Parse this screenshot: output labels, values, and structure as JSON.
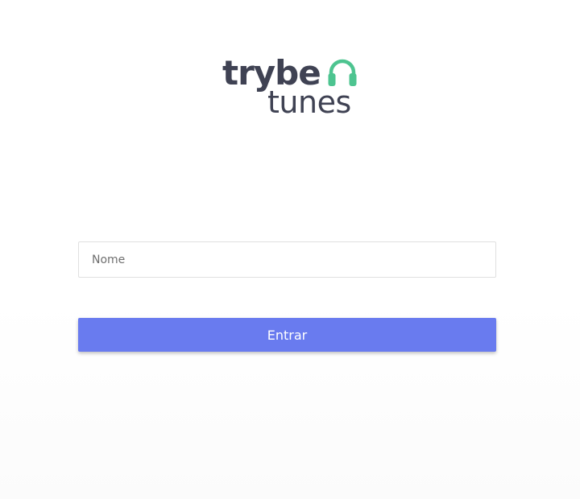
{
  "logo": {
    "line1": "trybe",
    "line2": "tunes",
    "icon": "headphones-icon",
    "text_color": "#3f4253",
    "icon_color": "#4dc490"
  },
  "login_form": {
    "name_placeholder": "Nome",
    "name_value": "",
    "submit_label": "Entrar",
    "button_color": "#697bef"
  }
}
